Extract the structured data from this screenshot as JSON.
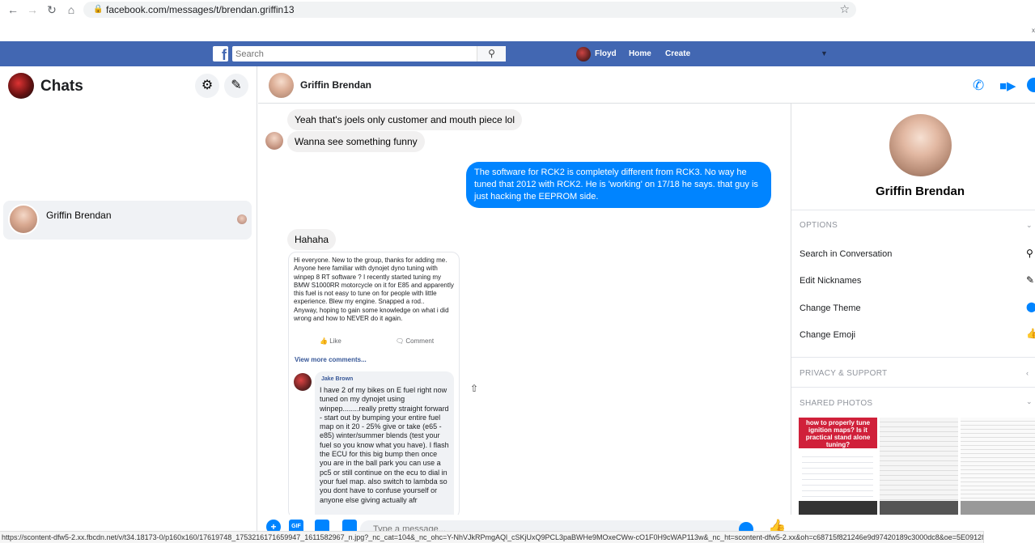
{
  "browser": {
    "url": "facebook.com/messages/t/brendan.griffin13",
    "close_glyph": "x"
  },
  "fb_bar": {
    "logo": "f",
    "search_placeholder": "Search",
    "user_name": "Floyd",
    "home_label": "Home",
    "create_label": "Create"
  },
  "sidebar": {
    "title": "Chats",
    "conversations": [
      {
        "name": "Griffin Brendan"
      }
    ]
  },
  "conversation": {
    "contact_name": "Griffin Brendan",
    "messages": [
      {
        "from": "them",
        "text": "Yeah that's joels only customer and mouth piece lol"
      },
      {
        "from": "them",
        "text": "Wanna see something funny"
      },
      {
        "from": "me",
        "text": "The software for RCK2 is completely different from RCK3. No way he tuned that 2012 with RCK2. He is 'working' on 17/18 he says. that guy is just hacking the EEPROM side."
      },
      {
        "from": "them",
        "text": "Hahaha"
      }
    ],
    "shared_screenshot": {
      "post_text": "Hi everyone. New to the group, thanks for adding me. Anyone here familiar with dynojet dyno tuning with winpep 8 RT software ? I recently started tuning my BMW S1000RR motorcycle on it for E85 and apparently this fuel is not easy to tune on for people with little experience. Blew my engine. Snapped a rod..\nAnyway, hoping to gain some knowledge on what i did wrong and how to NEVER do it again.",
      "like_label": "Like",
      "comment_label": "Comment",
      "view_more": "View more comments...",
      "commenter": "Jake Brown",
      "comment_text": "I have 2 of my bikes on E fuel right now tuned on my dynojet using winpep........really pretty straight forward - start out by bumping your entire fuel map on it 20 - 25% give or take (e65 - e85) winter/summer blends (test your fuel so you know what you have). I flash the ECU for this big bump then once you are in the ball park you can use a pc5 or still continue on the ecu to dial in your fuel map. also switch to lambda  so you dont have to confuse yourself or anyone else giving actually afr"
    },
    "composer_placeholder": "Type a message..."
  },
  "right_panel": {
    "name": "Griffin Brendan",
    "options_heading": "OPTIONS",
    "options": [
      {
        "label": "Search in Conversation",
        "icon": "search-icon"
      },
      {
        "label": "Edit Nicknames",
        "icon": "pencil-icon"
      },
      {
        "label": "Change Theme",
        "icon": "theme-icon"
      },
      {
        "label": "Change Emoji",
        "icon": "thumbs-up-icon"
      }
    ],
    "privacy_heading": "PRIVACY & SUPPORT",
    "photos_heading": "SHARED PHOTOS",
    "photo1_text": "how to properly tune ignition maps? Is it practical stand alone tuning?"
  },
  "status_bar": {
    "text": "https://scontent-dfw5-2.xx.fbcdn.net/v/t34.18173-0/p160x160/17619748_1753216171659947_1611582967_n.jpg?_nc_cat=104&_nc_ohc=Y-NhVJkRPmgAQl_cSKjUxQ9PCL3paBWHe9MOxeCWw-cO1F0H9cWAP113w&_nc_ht=scontent-dfw5-2.xx&oh=c68715f821246e9d97420189c3000dc8&oe=5E09128E"
  },
  "colors": {
    "fb_blue": "#4267b2",
    "messenger_blue": "#0084ff",
    "bubble_gray": "#f1f0f0"
  }
}
